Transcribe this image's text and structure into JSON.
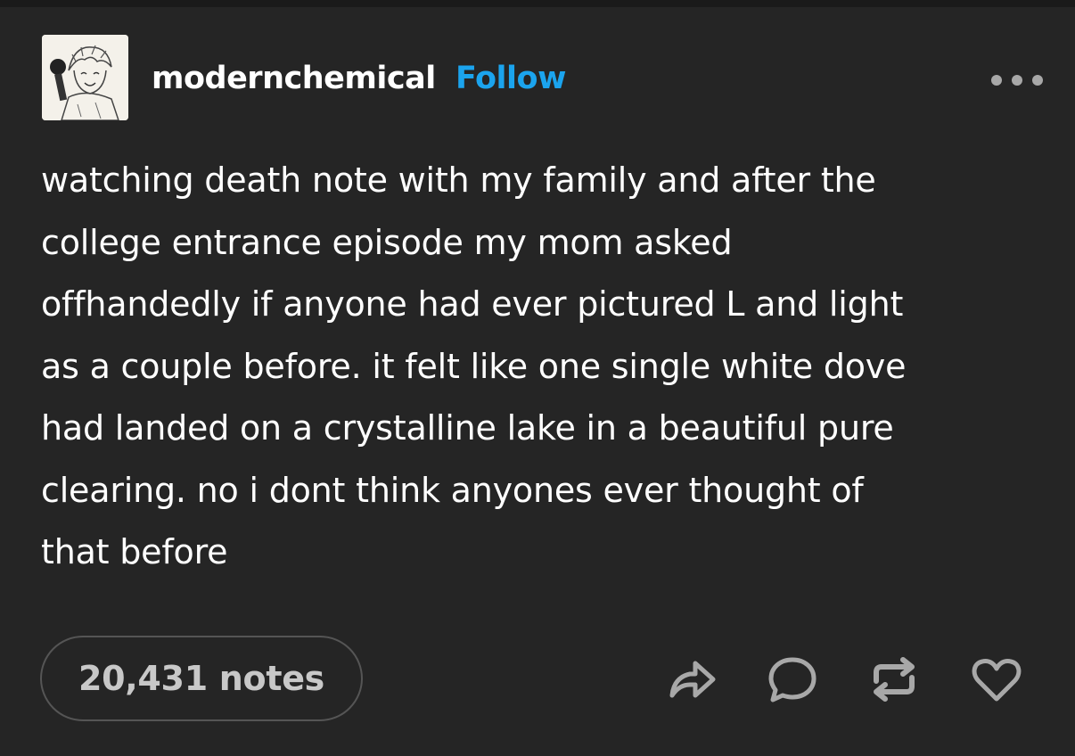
{
  "post": {
    "username": "modernchemical",
    "follow_label": "Follow",
    "body": "watching death note with my family and after the\ncollege entrance episode my mom asked\noffhandedly if anyone had ever pictured L and light\nas a couple before. it felt like one single white dove\nhad landed on a crystalline lake in a beautiful pure\nclearing. no i dont think anyones ever thought of\nthat before",
    "notes_label": "20,431 notes"
  },
  "icons": {
    "more": "more-icon",
    "share": "share-icon",
    "reply": "reply-icon",
    "reblog": "reblog-icon",
    "like": "heart-icon"
  },
  "colors": {
    "background": "#252525",
    "text": "#ffffff",
    "follow": "#1ba4ee",
    "muted": "#a8a8a8",
    "notes_border": "#555555"
  }
}
